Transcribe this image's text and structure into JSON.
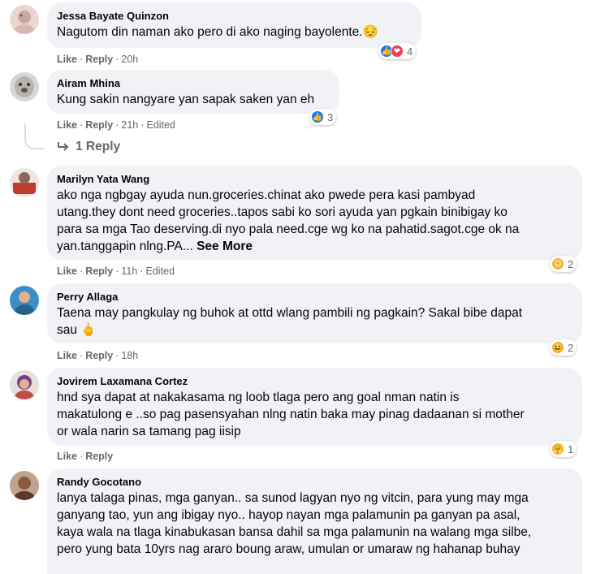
{
  "colors": {
    "bubble": "#f0f2f5",
    "meta": "#65676b",
    "like": "#1877f2",
    "love": "#f33e58",
    "sad": "#f7b125"
  },
  "actions": {
    "like": "Like",
    "reply": "Reply",
    "sep": "·"
  },
  "comments": [
    {
      "author": "Jessa Bayate Quinzon",
      "text": "Nagutom din naman ako pero di ako naging bayolente.😔",
      "time": "20h",
      "edited": "",
      "reactions": [
        "like-icon",
        "heart-icon"
      ],
      "reaction_count": "4"
    },
    {
      "author": "Airam Mhina",
      "text": "Kung sakin nangyare yan sapak saken yan eh",
      "time": "21h",
      "edited": "Edited",
      "reactions": [
        "like-icon"
      ],
      "reaction_count": "3",
      "replies_label": "1 Reply"
    },
    {
      "author": "Marilyn Yata Wang",
      "lines": [
        "ako nga ngbgay ayuda nun.groceries.chinat ako pwede pera kasi pambyad",
        "utang.they dont need groceries..tapos sabi ko sori ayuda yan pgkain binibigay ko",
        "para sa mga Tao deserving.di nyo pala need.cge wg ko na pahatid.sagot.cge ok na",
        "yan.tanggapin nlng.PA..."
      ],
      "see_more": "See More",
      "time": "11h",
      "edited": "Edited",
      "reactions": [
        "sad-icon"
      ],
      "reaction_count": "2"
    },
    {
      "author": "Perry Allaga",
      "lines": [
        "Taena may pangkulay ng buhok at ottd wlang pambili ng pagkain? Sakal bibe dapat",
        "sau 🖕"
      ],
      "time": "18h",
      "edited": "",
      "reactions": [
        "haha-icon"
      ],
      "reaction_count": "2"
    },
    {
      "author": "Jovirem Laxamana Cortez",
      "lines": [
        "hnd sya dapat at nakakasama ng loob tlaga pero ang goal nman natin is",
        "makatulong e ..so pag pasensyahan nlng natin baka may pinag dadaanan si mother",
        "or wala narin sa tamang pag iisip"
      ],
      "time": "",
      "edited": "",
      "reactions": [
        "care-icon"
      ],
      "reaction_count": "1"
    },
    {
      "author": "Randy Gocotano",
      "lines": [
        "lanya talaga pinas, mga ganyan.. sa sunod lagyan nyo ng vitcin, para yung may mga",
        "ganyang tao, yun ang ibigay nyo.. hayop nayan mga palamunin pa ganyan pa asal,",
        "kaya wala na tlaga kinabukasan bansa dahil sa mga palamunin na walang mga silbe,",
        "pero yung bata 10yrs nag araro boung araw, umulan or umaraw ng hahanap buhay"
      ]
    }
  ]
}
